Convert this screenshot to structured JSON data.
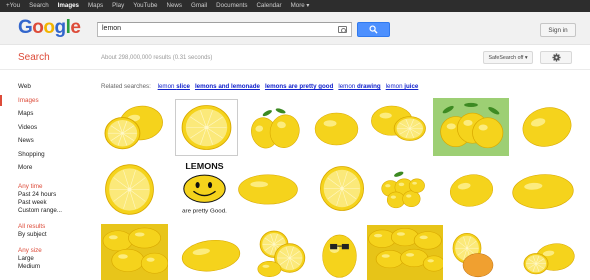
{
  "topbar": {
    "links": [
      "+You",
      "Search",
      "Images",
      "Maps",
      "Play",
      "YouTube",
      "News",
      "Gmail",
      "Documents",
      "Calendar",
      "More ▾"
    ],
    "active_index": 2
  },
  "header": {
    "logo_text": "Google",
    "logo_colors": [
      "#3366cc",
      "#dd4b39",
      "#f2b400",
      "#3366cc",
      "#2a9e3f",
      "#dd4b39"
    ],
    "search_value": "lemon",
    "sign_in_label": "Sign in"
  },
  "subbar": {
    "section_title": "Search",
    "result_stats": "About 298,000,000 results (0.31 seconds)",
    "safesearch_label": "SafeSearch off ▾"
  },
  "sidebar": {
    "items": [
      "Web",
      "Images",
      "Maps",
      "Videos",
      "News",
      "Shopping",
      "More"
    ],
    "active_index": 1,
    "any_time_title": "Any time",
    "any_time_options": [
      "Past 24 hours",
      "Past week",
      "Custom range..."
    ],
    "all_results_title": "All results",
    "all_results_options": [
      "By subject"
    ],
    "any_size_title": "Any size",
    "any_size_options": [
      "Large",
      "Medium"
    ]
  },
  "related": {
    "label": "Related searches:",
    "links": [
      {
        "prefix": "lemon ",
        "bold": "slice"
      },
      {
        "prefix": "",
        "bold": "lemons and lemonade"
      },
      {
        "prefix": "",
        "bold": "lemons are pretty good"
      },
      {
        "prefix": "lemon ",
        "bold": "drawing"
      },
      {
        "prefix": "lemon ",
        "bold": "juice"
      }
    ]
  },
  "images": {
    "lemons_drawing_title": "LEMONS",
    "lemons_drawing_caption": "are pretty Good.",
    "accent_colors": {
      "lemon": "#f5d31c",
      "lemon_dark": "#d9a900",
      "leaf": "#3d8a22",
      "link": "#1122cc",
      "red": "#dd4b39"
    }
  }
}
